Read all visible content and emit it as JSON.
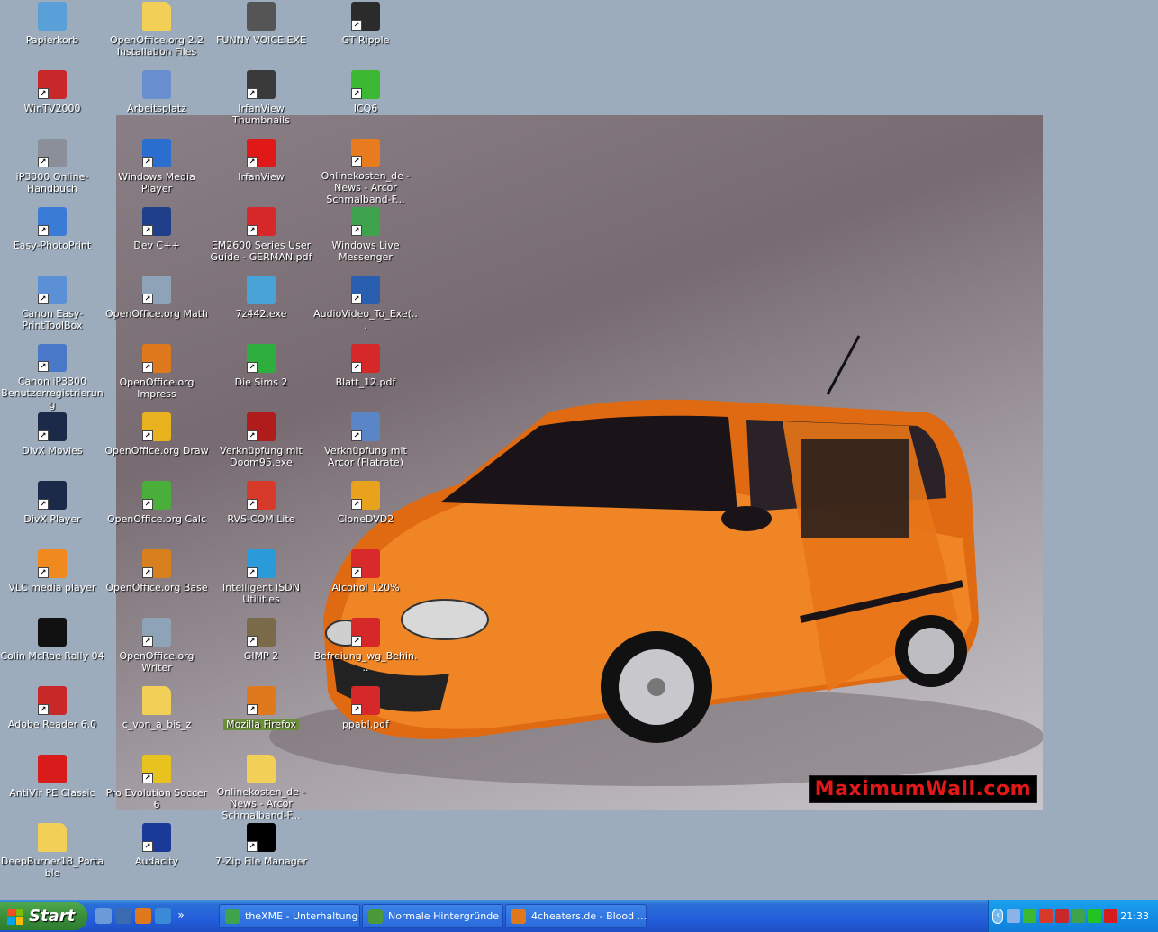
{
  "desktop": {
    "wallpaper_watermark": "MaximumWall.com",
    "icons": [
      {
        "label": "Papierkorb",
        "icon": "recycle-bin-icon",
        "color": "#5aa0d8",
        "col": 0,
        "row": 0,
        "shortcut": false
      },
      {
        "label": "OpenOffice.org 2.2 Installation Files",
        "icon": "folder-icon",
        "color": "#f2cf56",
        "col": 1,
        "row": 0,
        "shortcut": false
      },
      {
        "label": "FUNNY VOICE.EXE",
        "icon": "microphone-icon",
        "color": "#555555",
        "col": 2,
        "row": 0,
        "shortcut": false
      },
      {
        "label": "GT Ripple",
        "icon": "r-logo-icon",
        "color": "#2b2b2b",
        "col": 3,
        "row": 0,
        "shortcut": true
      },
      {
        "label": "WinTV2000",
        "icon": "wintv-icon",
        "color": "#c8282a",
        "col": 0,
        "row": 1,
        "shortcut": true
      },
      {
        "label": "Arbeitsplatz",
        "icon": "computer-icon",
        "color": "#6a8fd0",
        "col": 1,
        "row": 1,
        "shortcut": false
      },
      {
        "label": "IrfanView Thumbnails",
        "icon": "panda-icon",
        "color": "#3a3a3a",
        "col": 2,
        "row": 1,
        "shortcut": true
      },
      {
        "label": "ICQ6",
        "icon": "icq-flower-icon",
        "color": "#3db832",
        "col": 3,
        "row": 1,
        "shortcut": true
      },
      {
        "label": "iP3300 Online-Handbuch",
        "icon": "printer-manual-icon",
        "color": "#8a8f99",
        "col": 0,
        "row": 2,
        "shortcut": true
      },
      {
        "label": "Windows Media Player",
        "icon": "media-player-icon",
        "color": "#2a6fd0",
        "col": 1,
        "row": 2,
        "shortcut": true
      },
      {
        "label": "IrfanView",
        "icon": "irfanview-splat-icon",
        "color": "#e01818",
        "col": 2,
        "row": 2,
        "shortcut": true
      },
      {
        "label": "Onlinekosten_de - News - Arcor Schmalband-F...",
        "icon": "firefox-document-icon",
        "color": "#e87b1e",
        "col": 3,
        "row": 2,
        "shortcut": true
      },
      {
        "label": "Easy-PhotoPrint",
        "icon": "photoprint-icon",
        "color": "#3a7bd5",
        "col": 0,
        "row": 3,
        "shortcut": true
      },
      {
        "label": "Dev C++",
        "icon": "dev-cpp-icon",
        "color": "#1f3f8a",
        "col": 1,
        "row": 3,
        "shortcut": true
      },
      {
        "label": "EM2600 Series User Guide - GERMAN.pdf",
        "icon": "pdf-icon",
        "color": "#d62828",
        "col": 2,
        "row": 3,
        "shortcut": true
      },
      {
        "label": "Windows Live Messenger",
        "icon": "messenger-icon",
        "color": "#3fa34d",
        "col": 3,
        "row": 3,
        "shortcut": true
      },
      {
        "label": "Canon Easy-PrintToolBox",
        "icon": "printtoolbox-icon",
        "color": "#5b8fd6",
        "col": 0,
        "row": 4,
        "shortcut": true
      },
      {
        "label": "OpenOffice.org Math",
        "icon": "oo-math-icon",
        "color": "#8fa3b8",
        "col": 1,
        "row": 4,
        "shortcut": true
      },
      {
        "label": "7z442.exe",
        "icon": "installer-icon",
        "color": "#4aa3d8",
        "col": 2,
        "row": 4,
        "shortcut": false
      },
      {
        "label": "AudioVideo_To_Exe(...",
        "icon": "audio-video-icon",
        "color": "#2a5fb0",
        "col": 3,
        "row": 4,
        "shortcut": true
      },
      {
        "label": "Canon iP3300 Benutzerregistrierung",
        "icon": "registration-icon",
        "color": "#4a78c8",
        "col": 0,
        "row": 5,
        "shortcut": true
      },
      {
        "label": "OpenOffice.org Impress",
        "icon": "oo-impress-icon",
        "color": "#e0791e",
        "col": 1,
        "row": 5,
        "shortcut": true
      },
      {
        "label": "Die Sims 2",
        "icon": "sims-plumbob-icon",
        "color": "#2eae3c",
        "col": 2,
        "row": 5,
        "shortcut": true
      },
      {
        "label": "Blatt_12.pdf",
        "icon": "pdf-icon",
        "color": "#d62828",
        "col": 3,
        "row": 5,
        "shortcut": true
      },
      {
        "label": "DivX Movies",
        "icon": "divx-icon",
        "color": "#1a2a48",
        "col": 0,
        "row": 6,
        "shortcut": true
      },
      {
        "label": "OpenOffice.org Draw",
        "icon": "oo-draw-icon",
        "color": "#e8b21e",
        "col": 1,
        "row": 6,
        "shortcut": true
      },
      {
        "label": "Verknüpfung mit Doom95.exe",
        "icon": "doom-icon",
        "color": "#b01c1c",
        "col": 2,
        "row": 6,
        "shortcut": true
      },
      {
        "label": "Verknüpfung mit Arcor (Flatrate)",
        "icon": "network-connection-icon",
        "color": "#5a86c8",
        "col": 3,
        "row": 6,
        "shortcut": true
      },
      {
        "label": "DivX Player",
        "icon": "divx-icon",
        "color": "#1a2a48",
        "col": 0,
        "row": 7,
        "shortcut": true
      },
      {
        "label": "OpenOffice.org Calc",
        "icon": "oo-calc-icon",
        "color": "#4aae3a",
        "col": 1,
        "row": 7,
        "shortcut": true
      },
      {
        "label": "RVS-COM Lite",
        "icon": "rvs-com-icon",
        "color": "#d83a2a",
        "col": 2,
        "row": 7,
        "shortcut": true
      },
      {
        "label": "CloneDVD2",
        "icon": "clonedvd-icon",
        "color": "#e8a21e",
        "col": 3,
        "row": 7,
        "shortcut": true
      },
      {
        "label": "VLC media player",
        "icon": "vlc-cone-icon",
        "color": "#f08a1e",
        "col": 0,
        "row": 8,
        "shortcut": true
      },
      {
        "label": "OpenOffice.org Base",
        "icon": "oo-base-icon",
        "color": "#d8801e",
        "col": 1,
        "row": 8,
        "shortcut": true
      },
      {
        "label": "Intelligent ISDN Utilities",
        "icon": "isdn-icon",
        "color": "#2a9ad8",
        "col": 2,
        "row": 8,
        "shortcut": true
      },
      {
        "label": "Alcohol 120%",
        "icon": "alcohol-icon",
        "color": "#d82a2a",
        "col": 3,
        "row": 8,
        "shortcut": true
      },
      {
        "label": "Colin McRae Rally 04",
        "icon": "rally-04-icon",
        "color": "#111111",
        "col": 0,
        "row": 9,
        "shortcut": false
      },
      {
        "label": "OpenOffice.org Writer",
        "icon": "oo-writer-icon",
        "color": "#8fa3b8",
        "col": 1,
        "row": 9,
        "shortcut": true
      },
      {
        "label": "GIMP 2",
        "icon": "gimp-icon",
        "color": "#7a6a4a",
        "col": 2,
        "row": 9,
        "shortcut": true
      },
      {
        "label": "Befreiung_wg_Behin...",
        "icon": "pdf-icon",
        "color": "#d62828",
        "col": 3,
        "row": 9,
        "shortcut": true
      },
      {
        "label": "Adobe Reader 6.0",
        "icon": "adobe-reader-icon",
        "color": "#c82828",
        "col": 0,
        "row": 10,
        "shortcut": true
      },
      {
        "label": "c_von_a_bis_z",
        "icon": "folder-icon",
        "color": "#f2cf56",
        "col": 1,
        "row": 10,
        "shortcut": false
      },
      {
        "label": "Mozilla Firefox",
        "icon": "firefox-icon",
        "color": "#e0781e",
        "col": 2,
        "row": 10,
        "shortcut": true,
        "selected": true
      },
      {
        "label": "ppabl.pdf",
        "icon": "pdf-icon",
        "color": "#d62828",
        "col": 3,
        "row": 10,
        "shortcut": true
      },
      {
        "label": "AntiVir PE Classic",
        "icon": "antivir-umbrella-icon",
        "color": "#d81c1c",
        "col": 0,
        "row": 11,
        "shortcut": false
      },
      {
        "label": "Pro Evolution Soccer 6",
        "icon": "pes6-icon",
        "color": "#e8c21e",
        "col": 1,
        "row": 11,
        "shortcut": true
      },
      {
        "label": "Onlinekosten_de - News - Arcor Schmalband-F...",
        "icon": "folder-icon",
        "color": "#f2cf56",
        "col": 2,
        "row": 11,
        "shortcut": false
      },
      {
        "label": "DeepBurner18_Portable",
        "icon": "folder-icon",
        "color": "#f2cf56",
        "col": 0,
        "row": 12,
        "shortcut": false
      },
      {
        "label": "Audacity",
        "icon": "audacity-headphones-icon",
        "color": "#1a3a9a",
        "col": 1,
        "row": 12,
        "shortcut": true
      },
      {
        "label": "7-Zip File Manager",
        "icon": "7zip-icon",
        "color": "#000000",
        "col": 2,
        "row": 12,
        "shortcut": true
      }
    ]
  },
  "taskbar": {
    "start_label": "Start",
    "quick_launch": [
      {
        "icon": "show-desktop-icon",
        "color": "#6a9ad8"
      },
      {
        "icon": "window-switch-icon",
        "color": "#3a6ab0"
      },
      {
        "icon": "firefox-icon",
        "color": "#e0781e"
      },
      {
        "icon": "internet-explorer-icon",
        "color": "#3a8ad8"
      }
    ],
    "quick_launch_more": "»",
    "tasks": [
      {
        "label": "theXME - Unterhaltung",
        "icon": "messenger-icon",
        "color": "#3fa34d"
      },
      {
        "label": "Normale Hintergründe",
        "icon": "msn-people-icon",
        "color": "#4a9a3a"
      },
      {
        "label": "4cheaters.de - Blood ...",
        "icon": "firefox-icon",
        "color": "#e0781e"
      }
    ],
    "tray": {
      "expand": "‹",
      "icons": [
        {
          "icon": "network-icon",
          "color": "#8ab4e8"
        },
        {
          "icon": "icq-tray-icon",
          "color": "#3db832"
        },
        {
          "icon": "rvs-com-tray-icon",
          "color": "#d83a2a"
        },
        {
          "icon": "shield-icon",
          "color": "#c8282a"
        },
        {
          "icon": "messenger-tray-icon",
          "color": "#3fa34d"
        },
        {
          "icon": "status-green-icon",
          "color": "#22c422"
        },
        {
          "icon": "antivir-tray-icon",
          "color": "#d81c1c"
        }
      ],
      "clock": "21:33"
    }
  }
}
